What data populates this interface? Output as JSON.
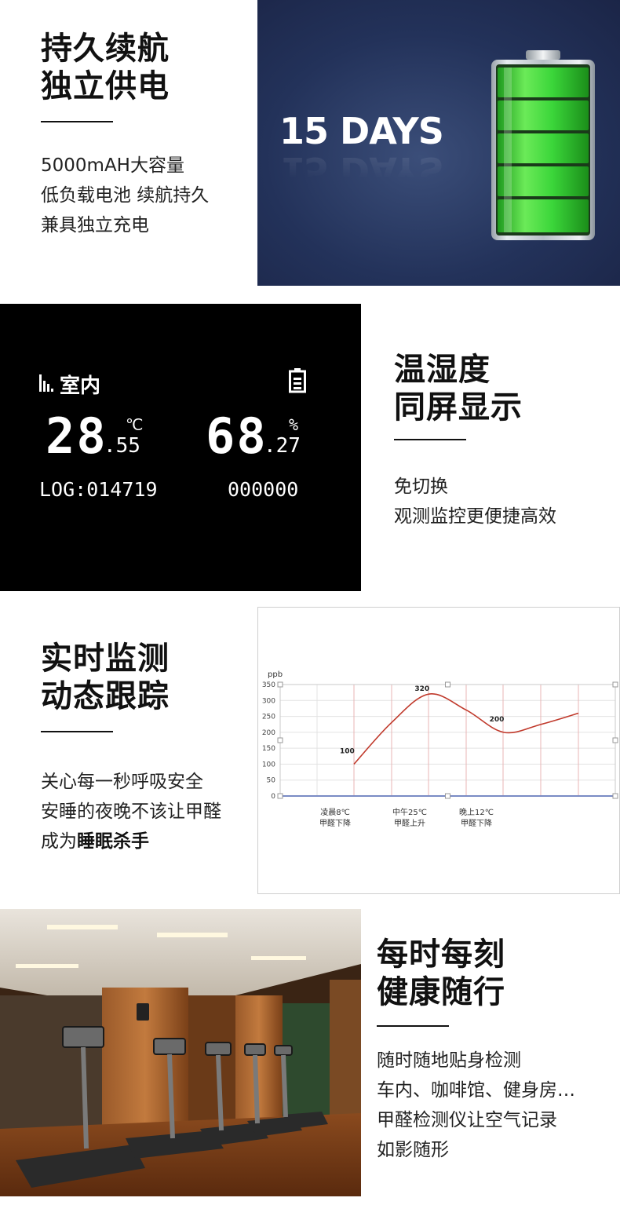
{
  "section1": {
    "title": "持久续航\n独立供电",
    "body": "5000mAH大容量\n低负载电池 续航持久\n兼具独立充电",
    "banner_text": "15 DAYS",
    "battery_color": "#3bd63a"
  },
  "section2": {
    "title": "温湿度\n同屏显示",
    "body": "免切换\n观测监控更便捷高效",
    "lcd": {
      "location": "室内",
      "temp_int": "28",
      "temp_dec": ".55",
      "temp_unit": "℃",
      "hum_int": "68",
      "hum_dec": ".27",
      "hum_unit": "%",
      "log": "LOG:014719",
      "counter": "000000"
    }
  },
  "section3": {
    "title": "实时监测\n动态跟踪",
    "body_plain": "关心每一秒呼吸安全\n安睡的夜晚不该让甲醛\n成为",
    "body_bold": "睡眠杀手"
  },
  "chart_data": {
    "type": "line",
    "ylabel": "ppb",
    "ylim": [
      0,
      350
    ],
    "yticks": [
      0,
      50,
      100,
      150,
      200,
      250,
      300,
      350
    ],
    "series": [
      {
        "color": "#c0392b",
        "x": [
          0,
          0.5,
          1,
          1.5,
          2,
          2.5,
          3
        ],
        "values": [
          100,
          230,
          320,
          270,
          200,
          225,
          260
        ]
      }
    ],
    "data_labels": [
      {
        "x": 0,
        "value": 100,
        "text": "100"
      },
      {
        "x": 1,
        "value": 320,
        "text": "320"
      },
      {
        "x": 2,
        "value": 200,
        "text": "200"
      }
    ],
    "x_annotations": [
      {
        "line1": "凌晨8℃",
        "line2": "甲醛下降"
      },
      {
        "line1": "中午25℃",
        "line2": "甲醛上升"
      },
      {
        "line1": "晚上12℃",
        "line2": "甲醛下降"
      }
    ]
  },
  "section4": {
    "title": "每时每刻\n健康随行",
    "body": "随时随地贴身检测\n车内、咖啡馆、健身房…\n甲醛检测仪让空气记录\n如影随形"
  }
}
